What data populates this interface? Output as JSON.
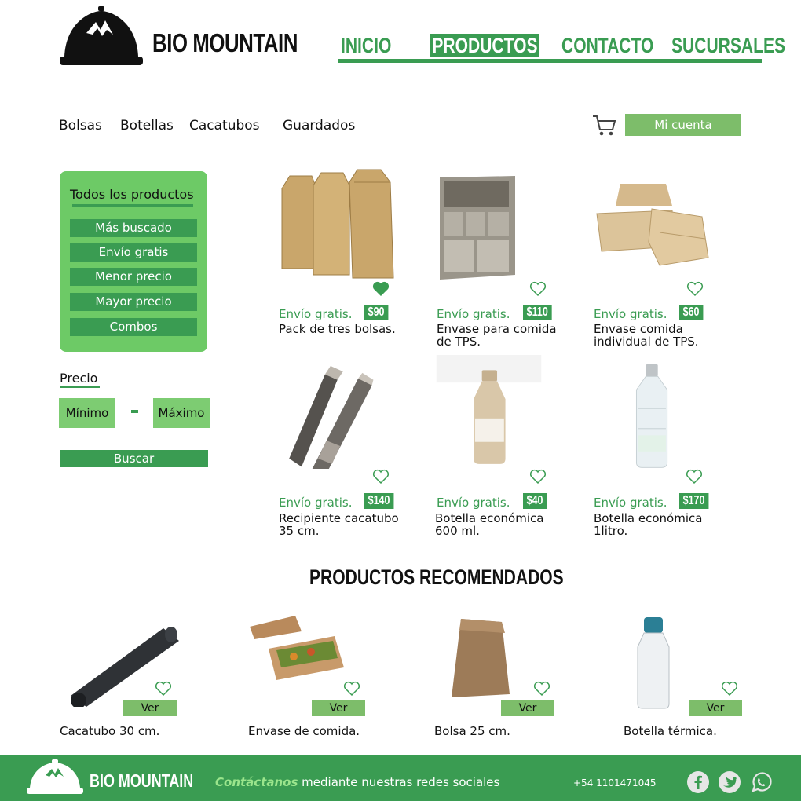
{
  "header": {
    "brand": "BIO MOUNTAIN",
    "nav": [
      "INICIO",
      "PRODUCTOS",
      "CONTACTO",
      "SUCURSALES"
    ],
    "active_nav": "PRODUCTOS"
  },
  "categories": [
    "Bolsas",
    "Botellas",
    "Cacatubos",
    "Guardados"
  ],
  "account_label": "Mi cuenta",
  "filters": {
    "title": "Todos los productos",
    "options": [
      "Más buscado",
      "Envío gratis",
      "Menor precio",
      "Mayor precio",
      "Combos"
    ]
  },
  "price_filter": {
    "label": "Precio",
    "min_label": "Mínimo",
    "max_label": "Máximo",
    "search_label": "Buscar"
  },
  "products": [
    {
      "shipping": "Envío gratis.",
      "price": "$90",
      "name": "Pack de tres bolsas.",
      "favorite": true,
      "image": "kraft-bags-icon"
    },
    {
      "shipping": "Envío gratis.",
      "price": "$110",
      "name": "Envase para comida de TPS.",
      "favorite": false,
      "image": "food-tray-icon"
    },
    {
      "shipping": "Envío gratis.",
      "price": "$60",
      "name": "Envase comida individual de TPS.",
      "favorite": false,
      "image": "clamshell-box-icon"
    },
    {
      "shipping": "Envío gratis.",
      "price": "$140",
      "name": "Recipiente cacatubo 35 cm.",
      "favorite": false,
      "image": "tube-container-icon"
    },
    {
      "shipping": "Envío gratis.",
      "price": "$40",
      "name": "Botella económica 600 ml.",
      "favorite": false,
      "image": "eco-bottle-icon"
    },
    {
      "shipping": "Envío gratis.",
      "price": "$170",
      "name": "Botella económica 1litro.",
      "favorite": false,
      "image": "clear-bottle-icon"
    }
  ],
  "recommended": {
    "title": "PRODUCTOS RECOMENDADOS",
    "view_label": "Ver",
    "items": [
      {
        "name": "Cacatubo  30 cm.",
        "image": "black-tube-icon"
      },
      {
        "name": "Envase de comida.",
        "image": "takeout-box-icon"
      },
      {
        "name": "Bolsa 25 cm.",
        "image": "paper-bag-icon"
      },
      {
        "name": "Botella térmica.",
        "image": "water-bottle-icon"
      }
    ]
  },
  "footer": {
    "brand": "BIO MOUNTAIN",
    "contact_em": "Contáctanos",
    "contact_rest": " mediante nuestras redes sociales",
    "phone": "+54 1101471045",
    "social": [
      "facebook-icon",
      "twitter-icon",
      "whatsapp-icon"
    ]
  },
  "colors": {
    "primary": "#3a9c52",
    "light": "#7dbd6a",
    "panel": "#6dca66"
  }
}
